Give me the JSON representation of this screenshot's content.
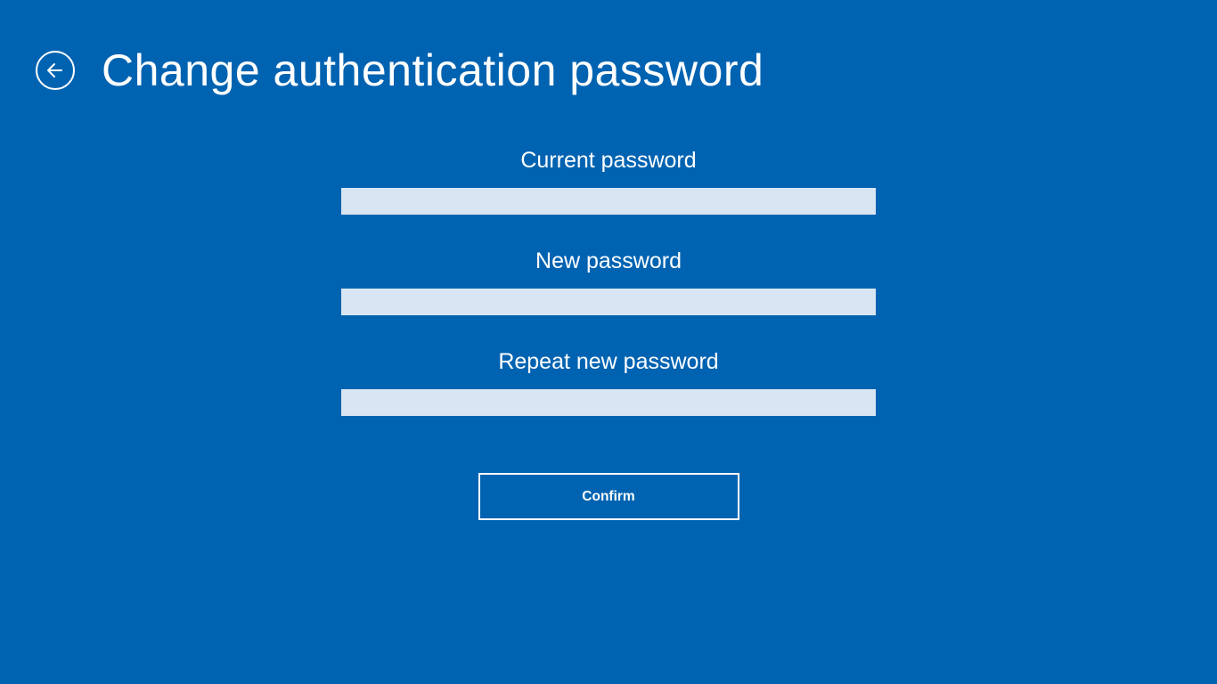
{
  "header": {
    "title": "Change authentication password"
  },
  "form": {
    "fields": [
      {
        "label": "Current password",
        "value": ""
      },
      {
        "label": "New password",
        "value": ""
      },
      {
        "label": "Repeat new password",
        "value": ""
      }
    ],
    "confirm_label": "Confirm"
  }
}
